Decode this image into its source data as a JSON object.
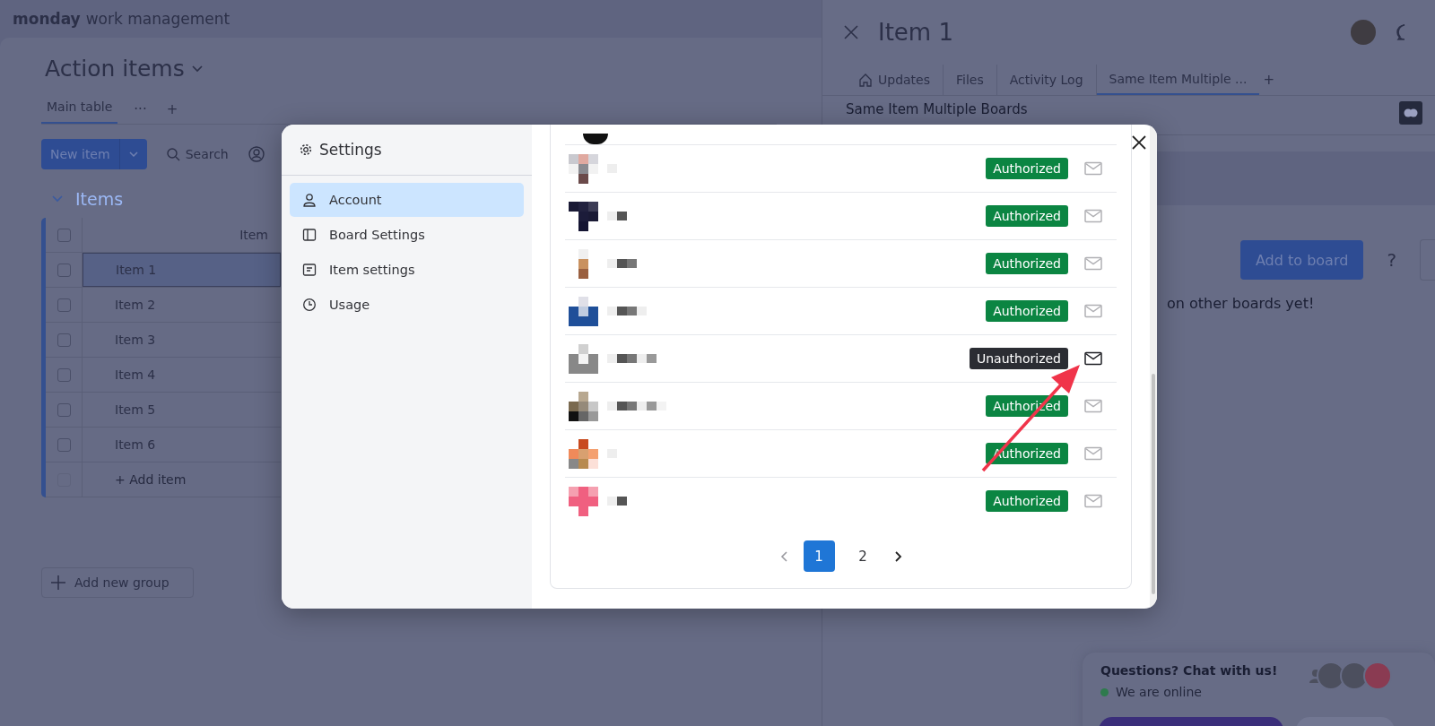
{
  "app": {
    "logo": "monday",
    "product": "work management"
  },
  "board": {
    "title": "Action items",
    "views": [
      {
        "label": "Main table",
        "selected": true
      }
    ],
    "view_menu": "···",
    "add_view": "+",
    "new_item": "New item",
    "search": "Search",
    "group": {
      "title": "Items",
      "column": "Item",
      "select_all_checked": false,
      "rows": [
        {
          "name": "Item 1",
          "selected": true,
          "checked": false
        },
        {
          "name": "Item 2",
          "selected": false,
          "checked": false
        },
        {
          "name": "Item 3",
          "selected": false,
          "checked": false
        },
        {
          "name": "Item 4",
          "selected": false,
          "checked": false
        },
        {
          "name": "Item 5",
          "selected": false,
          "checked": false
        },
        {
          "name": "Item 6",
          "selected": false,
          "checked": false
        }
      ],
      "add_item": "+ Add item",
      "add_item_checked": false
    },
    "add_group": "Add new group"
  },
  "item_panel": {
    "title": "Item 1",
    "tabs": [
      {
        "label": "Updates",
        "selected": false
      },
      {
        "label": "Files",
        "selected": false
      },
      {
        "label": "Activity Log",
        "selected": false
      },
      {
        "label": "Same Item Multiple ...",
        "selected": true
      }
    ],
    "add_tab": "+",
    "section_title": "Same Item Multiple Boards",
    "add_button": "Add to board",
    "help": "?",
    "empty_text": "on other boards yet!"
  },
  "settings": {
    "title": "Settings",
    "menu": [
      {
        "label": "Account",
        "selected": true
      },
      {
        "label": "Board Settings",
        "selected": false
      },
      {
        "label": "Item settings",
        "selected": false
      },
      {
        "label": "Usage",
        "selected": false
      }
    ],
    "users": [
      {
        "status": "Authorized",
        "authorized": true
      },
      {
        "status": "Authorized",
        "authorized": true
      },
      {
        "status": "Authorized",
        "authorized": true
      },
      {
        "status": "Authorized",
        "authorized": true
      },
      {
        "status": "Unauthorized",
        "authorized": false
      },
      {
        "status": "Authorized",
        "authorized": true
      },
      {
        "status": "Authorized",
        "authorized": true
      },
      {
        "status": "Authorized",
        "authorized": true
      }
    ],
    "pages": [
      {
        "label": "1",
        "selected": true
      },
      {
        "label": "2",
        "selected": false
      }
    ]
  },
  "chat": {
    "title": "Questions? Chat with us!",
    "status": "We are online"
  }
}
